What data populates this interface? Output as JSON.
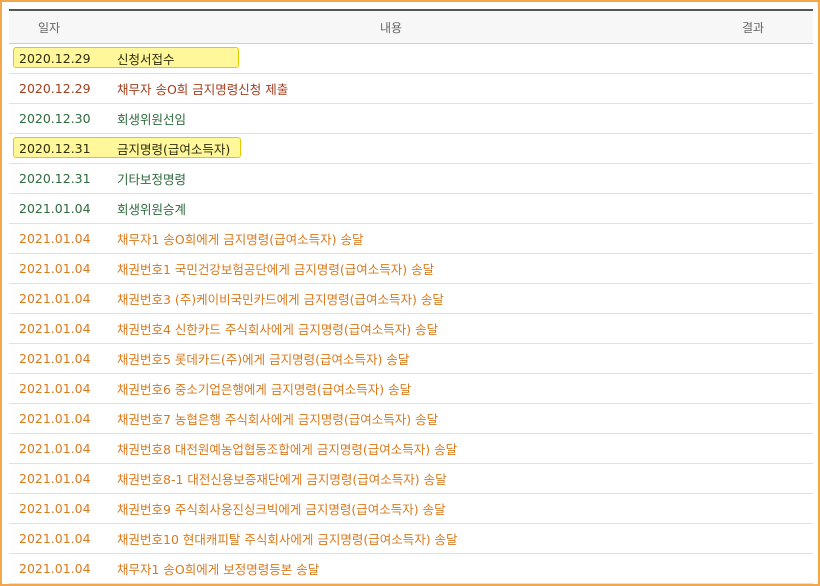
{
  "table": {
    "headers": {
      "date": "일자",
      "content": "내용",
      "result": "결과"
    },
    "rows": [
      {
        "date": "2020.12.29",
        "content": "신청서접수",
        "result": "",
        "color": "#2d2d10",
        "highlight": true
      },
      {
        "date": "2020.12.29",
        "content": "채무자 송O희 금지명령신청 제출",
        "result": "",
        "color": "#a13e1e",
        "highlight": false
      },
      {
        "date": "2020.12.30",
        "content": "회생위원선임",
        "result": "",
        "color": "#2d6a3c",
        "highlight": false
      },
      {
        "date": "2020.12.31",
        "content": "금지명령(급여소득자)",
        "result": "",
        "color": "#2d2d10",
        "highlight": true
      },
      {
        "date": "2020.12.31",
        "content": "기타보정명령",
        "result": "",
        "color": "#2d6a3c",
        "highlight": false
      },
      {
        "date": "2021.01.04",
        "content": "회생위원승계",
        "result": "",
        "color": "#2d6a3c",
        "highlight": false
      },
      {
        "date": "2021.01.04",
        "content": "채무자1 송O희에게 금지명령(급여소득자) 송달",
        "result": "",
        "color": "#d97a1d",
        "highlight": false
      },
      {
        "date": "2021.01.04",
        "content": "채권번호1 국민건강보험공단에게 금지명령(급여소득자) 송달",
        "result": "",
        "color": "#d97a1d",
        "highlight": false
      },
      {
        "date": "2021.01.04",
        "content": "채권번호3 (주)케이비국민카드에게 금지명령(급여소득자) 송달",
        "result": "",
        "color": "#d97a1d",
        "highlight": false
      },
      {
        "date": "2021.01.04",
        "content": "채권번호4 신한카드 주식회사에게 금지명령(급여소득자) 송달",
        "result": "",
        "color": "#d97a1d",
        "highlight": false
      },
      {
        "date": "2021.01.04",
        "content": "채권번호5 롯데카드(주)에게 금지명령(급여소득자) 송달",
        "result": "",
        "color": "#d97a1d",
        "highlight": false
      },
      {
        "date": "2021.01.04",
        "content": "채권번호6 중소기업은행에게 금지명령(급여소득자) 송달",
        "result": "",
        "color": "#d97a1d",
        "highlight": false
      },
      {
        "date": "2021.01.04",
        "content": "채권번호7 농협은행 주식회사에게 금지명령(급여소득자) 송달",
        "result": "",
        "color": "#d97a1d",
        "highlight": false
      },
      {
        "date": "2021.01.04",
        "content": "채권번호8 대전원예농업협동조합에게 금지명령(급여소득자) 송달",
        "result": "",
        "color": "#d97a1d",
        "highlight": false
      },
      {
        "date": "2021.01.04",
        "content": "채권번호8-1 대전신용보증재단에게 금지명령(급여소득자) 송달",
        "result": "",
        "color": "#d97a1d",
        "highlight": false
      },
      {
        "date": "2021.01.04",
        "content": "채권번호9 주식회사웅진싱크빅에게 금지명령(급여소득자) 송달",
        "result": "",
        "color": "#d97a1d",
        "highlight": false
      },
      {
        "date": "2021.01.04",
        "content": "채권번호10 현대캐피탈 주식회사에게 금지명령(급여소득자) 송달",
        "result": "",
        "color": "#d97a1d",
        "highlight": false
      },
      {
        "date": "2021.01.04",
        "content": "채무자1 송O희에게 보정명령등본 송달",
        "result": "",
        "color": "#d97a1d",
        "highlight": false
      }
    ]
  }
}
